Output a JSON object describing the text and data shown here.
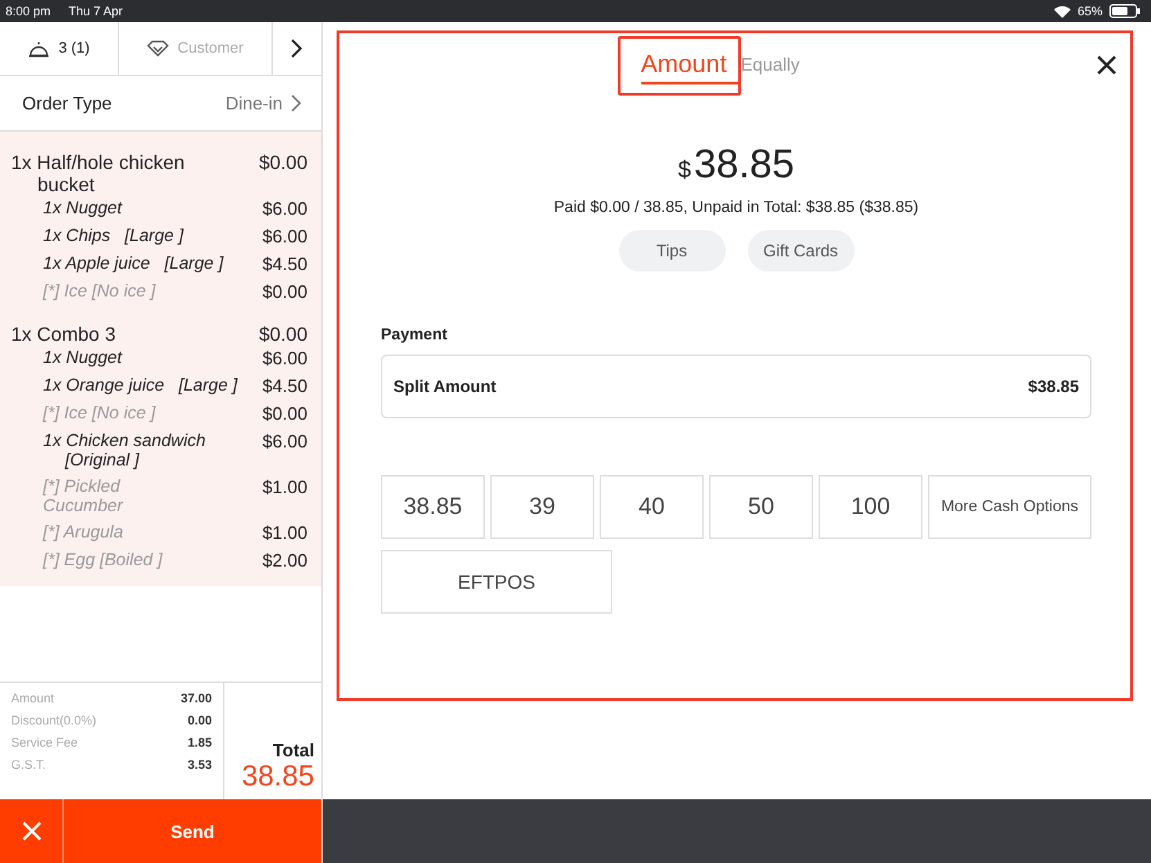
{
  "status_bar": {
    "time": "8:00 pm",
    "date": "Thu 7 Apr",
    "battery": "65%"
  },
  "order_header": {
    "guests": "3 (1)",
    "customer_placeholder": "Customer"
  },
  "order_type": {
    "label": "Order Type",
    "value": "Dine-in"
  },
  "items": [
    {
      "kind": "main",
      "name": "1x Half/hole chicken bucket",
      "price": "$0.00"
    },
    {
      "kind": "sub",
      "name": "1x Nugget",
      "price": "$6.00"
    },
    {
      "kind": "sub",
      "name": "1x Chips",
      "option": "[Large ]",
      "price": "$6.00"
    },
    {
      "kind": "sub",
      "name": "1x Apple juice",
      "option": "[Large ]",
      "price": "$4.50"
    },
    {
      "kind": "modifier",
      "name": "[*] Ice  [No ice ]",
      "price": "$0.00"
    },
    {
      "kind": "main",
      "name": "1x Combo 3",
      "price": "$0.00"
    },
    {
      "kind": "sub",
      "name": "1x Nugget",
      "price": "$6.00"
    },
    {
      "kind": "sub",
      "name": "1x Orange juice",
      "option": "[Large ]",
      "price": "$4.50"
    },
    {
      "kind": "modifier",
      "name": "[*] Ice  [No ice ]",
      "price": "$0.00"
    },
    {
      "kind": "sub",
      "name": "1x Chicken sandwich",
      "option": "[Original ]",
      "price": "$6.00"
    },
    {
      "kind": "modifier",
      "name": "[*] Pickled Cucumber",
      "price": "$1.00"
    },
    {
      "kind": "modifier",
      "name": "[*] Arugula",
      "price": "$1.00"
    },
    {
      "kind": "modifier",
      "name": "[*] Egg  [Boiled ]",
      "price": "$2.00"
    }
  ],
  "summary": [
    {
      "label": "Amount",
      "value": "37.00"
    },
    {
      "label": "Discount(0.0%)",
      "value": "0.00"
    },
    {
      "label": "Service Fee",
      "value": "1.85"
    },
    {
      "label": "G.S.T.",
      "value": "3.53"
    }
  ],
  "total": {
    "label": "Total",
    "value": "38.85"
  },
  "send_button": "Send",
  "payment_dialog": {
    "tabs": [
      {
        "label": "Amount",
        "selected": true
      },
      {
        "label": "Equally",
        "selected": false
      }
    ],
    "currency": "$",
    "amount": "38.85",
    "paid_line": "Paid $0.00 / 38.85, Unpaid in Total: $38.85 ($38.85)",
    "extras": [
      "Tips",
      "Gift Cards"
    ],
    "payment_label": "Payment",
    "split": {
      "label": "Split Amount",
      "value": "$38.85"
    },
    "cash_options": [
      "38.85",
      "39",
      "40",
      "50",
      "100",
      "More Cash Options"
    ],
    "methods": [
      "EFTPOS"
    ]
  }
}
